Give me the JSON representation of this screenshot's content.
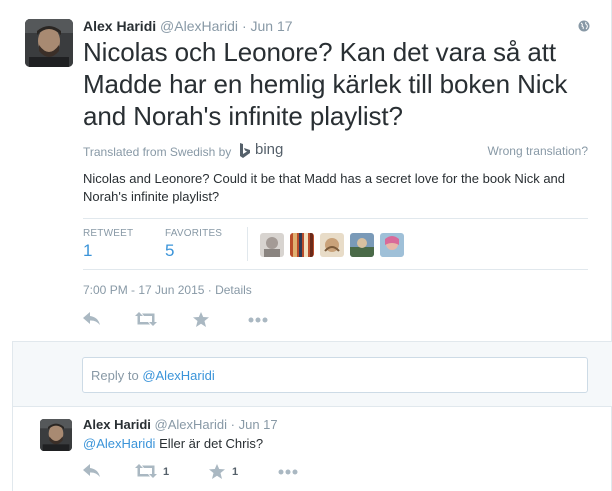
{
  "tweet": {
    "fullname": "Alex Haridi",
    "username": "@AlexHaridi",
    "separator": "·",
    "time": "Jun 17",
    "text": "Nicolas och Leonore? Kan det vara så att Madde har en hemlig kärlek till boken Nick and Norah's infinite playlist?",
    "translated_from": "Translated from Swedish by",
    "bing_label": "bing",
    "wrong_translation": "Wrong translation?",
    "translation": "Nicolas and Leonore? Could it be that Madd has a secret love for the book Nick and Norah's infinite playlist?",
    "retweets_label": "RETWEET",
    "retweets_count": "1",
    "favorites_label": "FAVORITES",
    "favorites_count": "5",
    "datetime": "7:00 PM - 17 Jun 2015",
    "datetime_sep": " · ",
    "details_link": "Details"
  },
  "reply_box": {
    "prefix": "Reply to ",
    "mention": "@AlexHaridi"
  },
  "reply": {
    "fullname": "Alex Haridi",
    "username": "@AlexHaridi",
    "separator": "·",
    "time": "Jun 17",
    "mention": "@AlexHaridi",
    "text": " Eller är det Chris?",
    "retweet_count": "1",
    "favorite_count": "1"
  },
  "icons": {
    "globe": "globe-icon",
    "reply": "reply-icon",
    "retweet": "retweet-icon",
    "favorite": "star-icon",
    "more": "more-icon",
    "bing": "bing-logo-icon"
  },
  "colors": {
    "link": "#3b94d9",
    "muted": "#8899a6",
    "text": "#292f33",
    "action_icon": "#aab8c2"
  }
}
